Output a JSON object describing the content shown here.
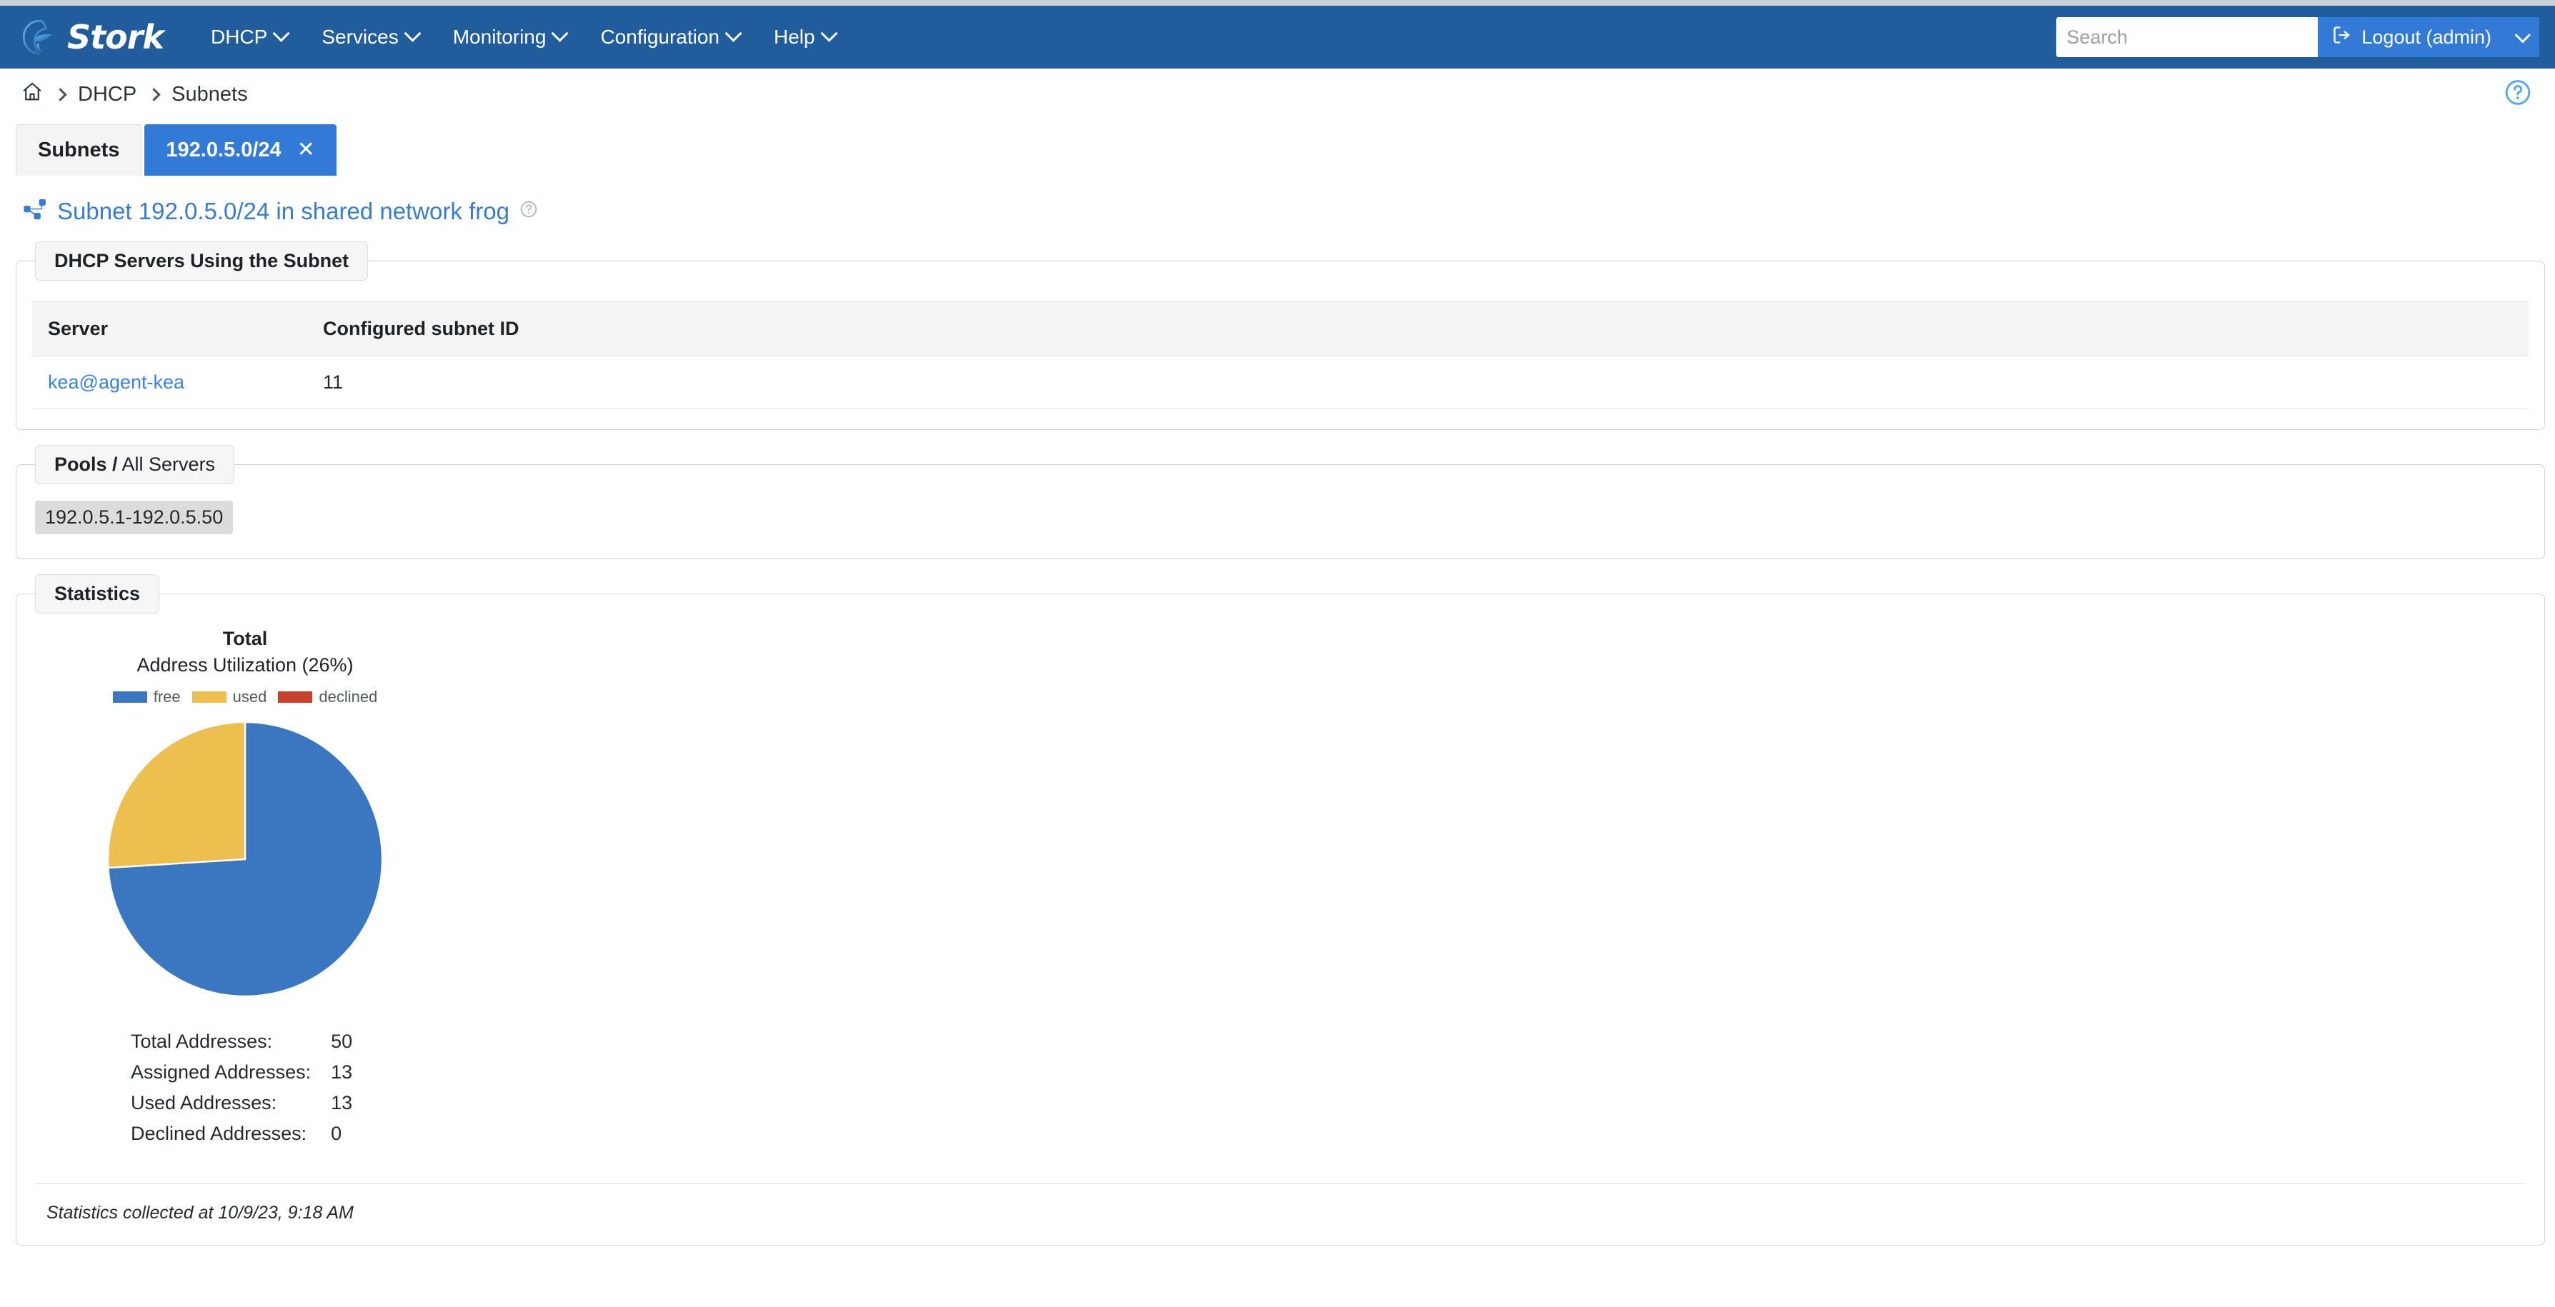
{
  "brand": {
    "name": "Stork",
    "logo_icon": "stork-bird-logo"
  },
  "navbar": {
    "items": [
      {
        "label": "DHCP"
      },
      {
        "label": "Services"
      },
      {
        "label": "Monitoring"
      },
      {
        "label": "Configuration"
      },
      {
        "label": "Help"
      }
    ],
    "search": {
      "value": "",
      "placeholder": "Search"
    },
    "logout": {
      "label": "Logout (admin)",
      "icon": "sign-out-icon"
    },
    "background_color": "#215d9c",
    "button_color": "#337ad7"
  },
  "breadcrumb": {
    "home_icon": "home-icon",
    "items": [
      {
        "label": "DHCP"
      },
      {
        "label": "Subnets"
      }
    ],
    "help_icon": "help-circle-icon"
  },
  "tabs": [
    {
      "label": "Subnets",
      "active": false
    },
    {
      "label": "192.0.5.0/24",
      "active": true,
      "closable": true,
      "close_glyph": "✕"
    }
  ],
  "page": {
    "icon": "subnet-sitemap-icon",
    "title": "Subnet 192.0.5.0/24 in shared network frog",
    "help_icon": "help-circle-icon"
  },
  "servers_panel": {
    "legend": "DHCP Servers Using the Subnet",
    "columns": [
      "Server",
      "Configured subnet ID"
    ],
    "rows": [
      {
        "server": "kea@agent-kea",
        "subnet_id": "11"
      }
    ]
  },
  "pools_panel": {
    "legend_bold": "Pools /",
    "legend_normal": " All Servers",
    "pools": [
      "192.0.5.1-192.0.5.50"
    ]
  },
  "statistics_panel": {
    "legend": "Statistics",
    "stats": [
      {
        "label": "Total Addresses:",
        "value": "50"
      },
      {
        "label": "Assigned Addresses:",
        "value": "13"
      },
      {
        "label": "Used Addresses:",
        "value": "13"
      },
      {
        "label": "Declined Addresses:",
        "value": "0"
      }
    ],
    "collected_at": "Statistics collected at 10/9/23, 9:18 AM"
  },
  "chart_data": {
    "type": "pie",
    "title": "Total",
    "subtitle": "Address Utilization (26%)",
    "utilization_percent": 26,
    "categories": [
      "free",
      "used",
      "declined"
    ],
    "values": [
      37,
      13,
      0
    ],
    "percents": [
      74,
      26,
      0
    ],
    "colors": [
      "#3b76c0",
      "#edbf4f",
      "#c8412a"
    ],
    "legend": [
      {
        "name": "free",
        "color": "#3b76c0"
      },
      {
        "name": "used",
        "color": "#edbf4f"
      },
      {
        "name": "declined",
        "color": "#c8412a"
      }
    ],
    "legend_position": "top",
    "grid": false,
    "start_angle_deg": 0,
    "direction": "clockwise"
  }
}
